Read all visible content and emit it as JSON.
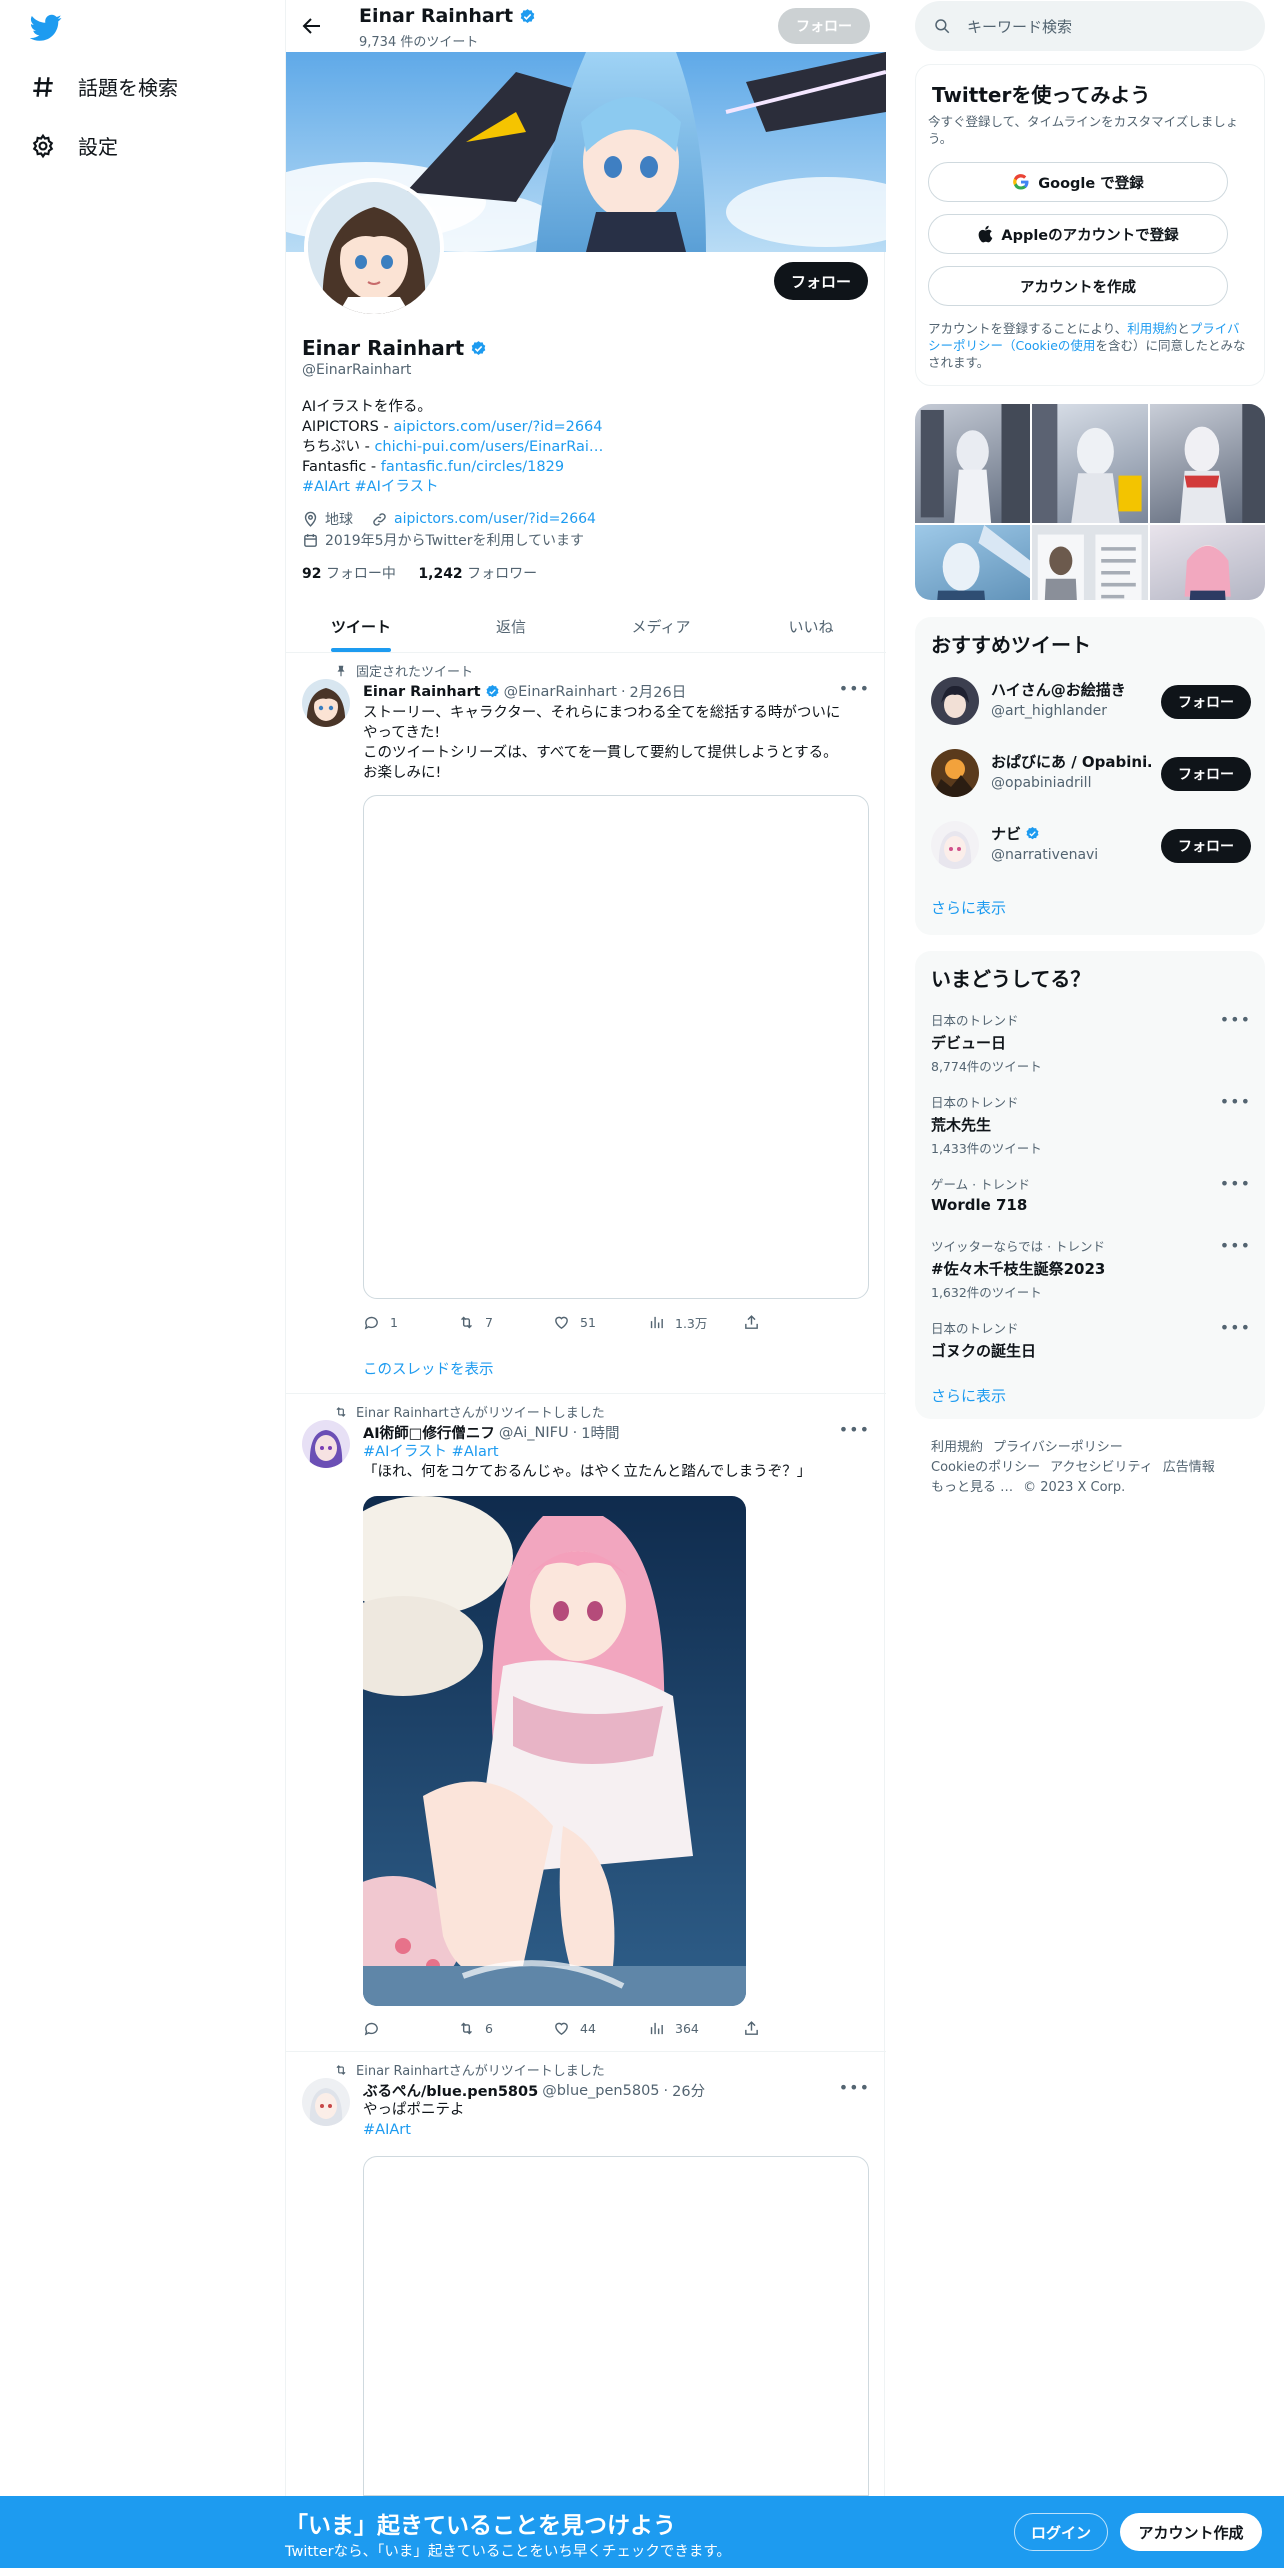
{
  "nav": {
    "explore_label": "話題を検索",
    "settings_label": "設定"
  },
  "header": {
    "name": "Einar Rainhart",
    "tweet_count": "9,734 件のツイート",
    "follow_label": "フォロー"
  },
  "profile": {
    "name": "Einar Rainhart",
    "handle": "@EinarRainhart",
    "follow_label": "フォロー",
    "bio_line1": "AIイラストを作る。",
    "bio_line2_prefix": "AIPICTORS - ",
    "bio_line2_link": "aipictors.com/user/?id=2664",
    "bio_line3_prefix": "ちちぷい - ",
    "bio_line3_link": "chichi-pui.com/users/EinarRai…",
    "bio_line4_prefix": "Fantasfic - ",
    "bio_line4_link": "fantasfic.fun/circles/1829",
    "bio_hashtags": "#AIArt #AIイラスト",
    "location": "地球",
    "website": "aipictors.com/user/?id=2664",
    "joined": "2019年5月からTwitterを利用しています",
    "following_count": "92",
    "following_label": "フォロー中",
    "followers_count": "1,242",
    "followers_label": "フォロワー"
  },
  "tabs": [
    {
      "label": "ツイート",
      "active": true
    },
    {
      "label": "返信",
      "active": false
    },
    {
      "label": "メディア",
      "active": false
    },
    {
      "label": "いいね",
      "active": false
    }
  ],
  "tweets": [
    {
      "context": "固定されたツイート",
      "name": "Einar Rainhart",
      "handle": "@EinarRainhart",
      "time": "2月26日",
      "text1": "ストーリー、キャラクター、それらにまつわる全てを総括する時がついに",
      "text2": "やってきた!",
      "text3": "このツイートシリーズは、すべてを一貫して要約して提供しようとする。",
      "text4": "お楽しみに!",
      "replies": "1",
      "retweets": "7",
      "likes": "51",
      "views": "1.3万",
      "show_thread": "このスレッドを表示"
    },
    {
      "context": "Einar Rainhartさんがリツイートしました",
      "name": "AI術師□修行僧ニフ",
      "handle": "@Ai_NIFU",
      "time": "1時間",
      "hashtags": "#AIイラスト #AIart",
      "text1": "「ほれ、何をコケておるんじゃ。はやく立たんと踏んでしまうぞ？」",
      "replies": "",
      "retweets": "6",
      "likes": "44",
      "views": "364"
    },
    {
      "context": "Einar Rainhartさんがリツイートしました",
      "name": "ぶるぺん/blue.pen5805",
      "handle": "@blue_pen5805",
      "time": "26分",
      "text1": "やっぱポニテよ",
      "hashtags": "#AIArt"
    }
  ],
  "sidebar": {
    "search_placeholder": "キーワード検索",
    "signup": {
      "title": "Twitterを使ってみよう",
      "subtitle": "今すぐ登録して、タイムラインをカスタマイズしましょう。",
      "google": "Google で登録",
      "apple": "Appleのアカウントで登録",
      "create": "アカウントを作成",
      "tos_1": "アカウントを登録することにより、",
      "tos_link1": "利用規約",
      "tos_2": "と",
      "tos_link2": "プライバシーポリシー（Cookieの使用",
      "tos_3": "を含む）に同意したとみなされます。"
    },
    "recommend": {
      "title": "おすすめツイート",
      "users": [
        {
          "name": "ハイさん@お絵描き",
          "handle": "@art_highlander",
          "verified": false
        },
        {
          "name": "おぱびにあ / Opabini…",
          "handle": "@opabiniadrill",
          "verified": false
        },
        {
          "name": "ナビ",
          "handle": "@narrativenavi",
          "verified": true
        }
      ],
      "follow_label": "フォロー",
      "more": "さらに表示"
    },
    "trends": {
      "title": "いまどうしてる？",
      "items": [
        {
          "category": "日本のトレンド",
          "name": "デビュー日",
          "count": "8,774件のツイート"
        },
        {
          "category": "日本のトレンド",
          "name": "荒木先生",
          "count": "1,433件のツイート"
        },
        {
          "category": "ゲーム · トレンド",
          "name": "Wordle 718",
          "count": ""
        },
        {
          "category": "ツイッターならでは · トレンド",
          "name": "#佐々木千枝生誕祭2023",
          "count": "1,632件のツイート"
        },
        {
          "category": "日本のトレンド",
          "name": "ゴヌクの誕生日",
          "count": ""
        }
      ],
      "more": "さらに表示"
    },
    "footer": {
      "terms": "利用規約",
      "privacy": "プライバシーポリシー",
      "cookie": "Cookieのポリシー",
      "accessibility": "アクセシビリティ",
      "ads": "広告情報",
      "more": "もっと見る …",
      "copyright": "© 2023 X Corp."
    }
  },
  "bottombar": {
    "title": "「いま」起きていることを見つけよう",
    "subtitle": "Twitterなら、「いま」起きていることをいち早くチェックできます。",
    "login": "ログイン",
    "signup": "アカウント作成"
  },
  "colors": {
    "accent": "#1d9bf0",
    "text": "#0f1419",
    "muted": "#536471"
  }
}
